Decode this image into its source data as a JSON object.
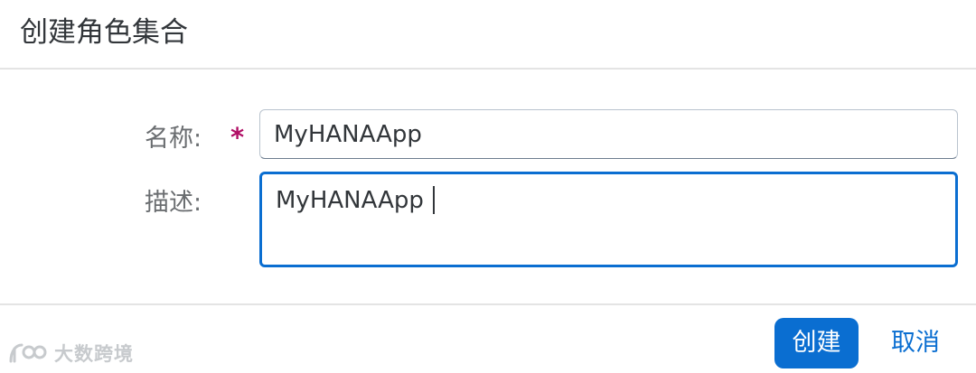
{
  "dialog": {
    "title": "创建角色集合"
  },
  "form": {
    "name": {
      "label": "名称:",
      "required_marker": "*",
      "value": "MyHANAApp"
    },
    "description": {
      "label": "描述:",
      "value": "MyHANAApp"
    }
  },
  "footer": {
    "create_label": "创建",
    "cancel_label": "取消"
  },
  "watermark": {
    "text": "大数跨境"
  },
  "colors": {
    "accent": "#0a6ed1",
    "required": "#b10f66",
    "label": "#6a6d70",
    "text": "#32363a",
    "divider": "#e4e4e4"
  }
}
